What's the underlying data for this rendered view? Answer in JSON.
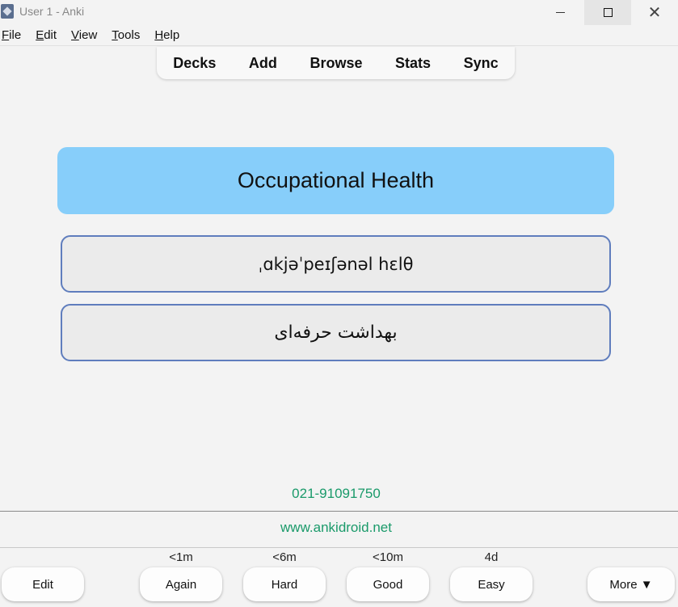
{
  "window": {
    "title": "User 1 - Anki",
    "close_glyph": "✕"
  },
  "menu": [
    {
      "mnemonic": "F",
      "rest": "ile"
    },
    {
      "mnemonic": "E",
      "rest": "dit"
    },
    {
      "mnemonic": "V",
      "rest": "iew"
    },
    {
      "mnemonic": "T",
      "rest": "ools"
    },
    {
      "mnemonic": "H",
      "rest": "elp"
    }
  ],
  "toolbar": {
    "decks": "Decks",
    "add": "Add",
    "browse": "Browse",
    "stats": "Stats",
    "sync": "Sync"
  },
  "card": {
    "front": "Occupational Health",
    "pronunciation": "ˌɑkjəˈpeɪʃənəl hɛlθ",
    "translation": "بهداشت حرفه‌ای",
    "phone": "021-91091750",
    "website": "www.ankidroid.net"
  },
  "answer_bar": {
    "edit": "Edit",
    "again": {
      "label": "Again",
      "interval": "<1m"
    },
    "hard": {
      "label": "Hard",
      "interval": "<6m"
    },
    "good": {
      "label": "Good",
      "interval": "<10m"
    },
    "easy": {
      "label": "Easy",
      "interval": "4d"
    },
    "more": "More ▼"
  },
  "colors": {
    "title_card_bg": "#87cefa",
    "box_border": "#5f7dbd",
    "footer_text": "#1a9a6a"
  }
}
